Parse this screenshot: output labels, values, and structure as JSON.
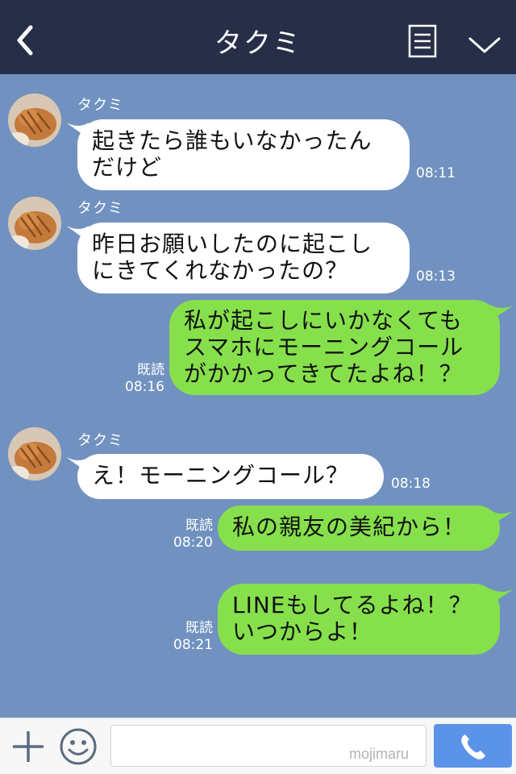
{
  "header": {
    "title": "タクミ"
  },
  "messages": [
    {
      "side": "left",
      "sender": "タクミ",
      "text": "起きたら誰もいなかったん\nだけど",
      "time": "08:11"
    },
    {
      "side": "left",
      "sender": "タクミ",
      "text": "昨日お願いしたのに起こし\nにきてくれなかったの？",
      "time": "08:13"
    },
    {
      "side": "right",
      "read": "既読",
      "text": "私が起こしにいかなくても\nスマホにモーニングコール\nがかかってきてたよね！？",
      "time": "08:16"
    },
    {
      "side": "left",
      "sender": "タクミ",
      "text": "え！モーニングコール？",
      "time": "08:18"
    },
    {
      "side": "right",
      "read": "既読",
      "text": "私の親友の美紀から！",
      "time": "08:20"
    },
    {
      "side": "right",
      "read": "既読",
      "text": "LINEもしてるよね！？\nいつからよ！",
      "time": "08:21"
    }
  ],
  "footer": {
    "input_value": "",
    "watermark": "mojimaru"
  },
  "colors": {
    "background": "#7192c0",
    "header": "#262f47",
    "bubble_left": "#ffffff",
    "bubble_right": "#86e04c",
    "call_button": "#5b93e8"
  },
  "icons": {
    "back": "chevron-left-icon",
    "menu": "note-icon",
    "collapse": "chevron-down-icon",
    "plus": "plus-icon",
    "emoji": "smiley-icon",
    "call": "phone-icon"
  }
}
